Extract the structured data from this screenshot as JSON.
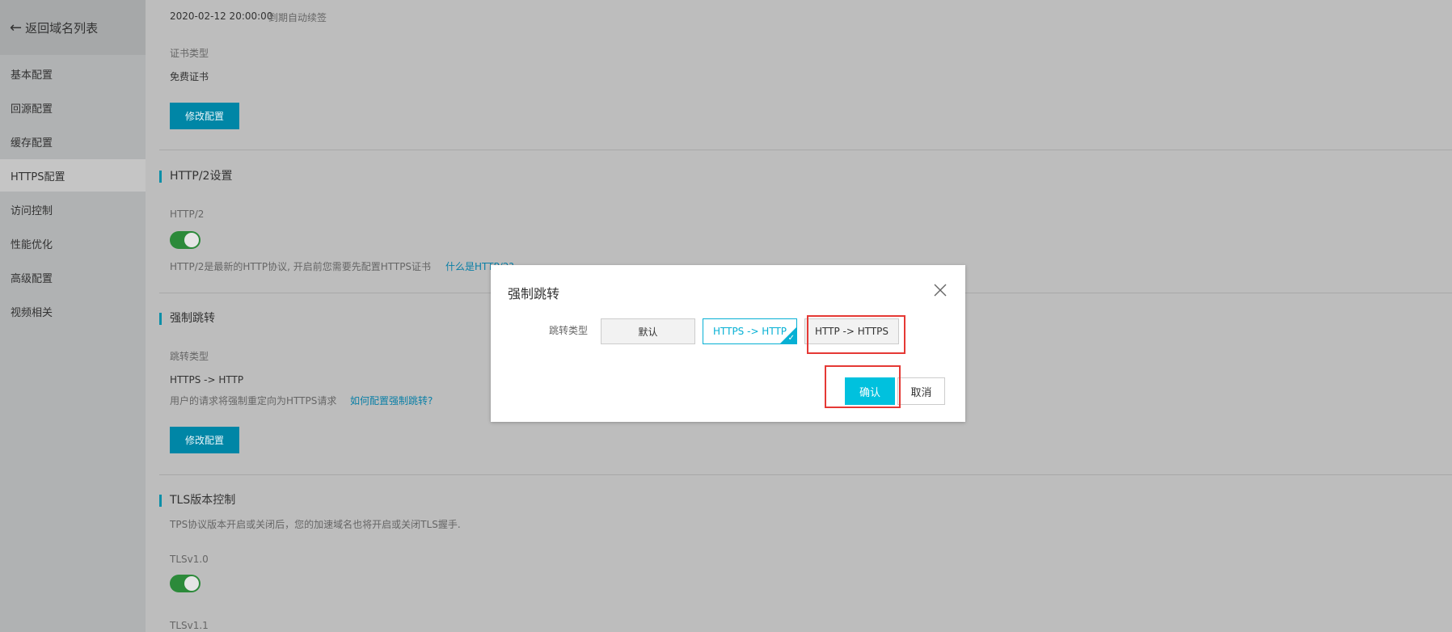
{
  "sidebar": {
    "back_label": "返回域名列表",
    "items": [
      {
        "label": "基本配置"
      },
      {
        "label": "回源配置"
      },
      {
        "label": "缓存配置"
      },
      {
        "label": "HTTPS配置"
      },
      {
        "label": "访问控制"
      },
      {
        "label": "性能优化"
      },
      {
        "label": "高级配置"
      },
      {
        "label": "视频相关"
      }
    ]
  },
  "cert": {
    "expiry": "2020-02-12 20:00:00",
    "renew_note": "到期自动续签",
    "type_label": "证书类型",
    "type_value": "免费证书",
    "modify_button": "修改配置"
  },
  "http2": {
    "section_title": "HTTP/2设置",
    "label": "HTTP/2",
    "enabled": true,
    "description": "HTTP/2是最新的HTTP协议, 开启前您需要先配置HTTPS证书",
    "help_link": "什么是HTTP/2?"
  },
  "redirect": {
    "section_title": "强制跳转",
    "type_label": "跳转类型",
    "type_value": "HTTPS -> HTTP",
    "description": "用户的请求将强制重定向为HTTPS请求",
    "help_link": "如何配置强制跳转?",
    "modify_button": "修改配置"
  },
  "tls": {
    "section_title": "TLS版本控制",
    "description": "TPS协议版本开启或关闭后，您的加速域名也将开启或关闭TLS握手.",
    "v10_label": "TLSv1.0",
    "v10_enabled": true,
    "v11_label": "TLSv1.1"
  },
  "modal": {
    "title": "强制跳转",
    "field_label": "跳转类型",
    "options": [
      {
        "label": "默认",
        "selected": false
      },
      {
        "label": "HTTPS -> HTTP",
        "selected": true
      },
      {
        "label": "HTTP -> HTTPS",
        "selected": false
      }
    ],
    "confirm_label": "确认",
    "cancel_label": "取消"
  },
  "colors": {
    "primary": "#00c1de",
    "button_dimmed": "#0086a6",
    "toggle_on": "#2c8a3a",
    "highlight": "#e53935"
  }
}
